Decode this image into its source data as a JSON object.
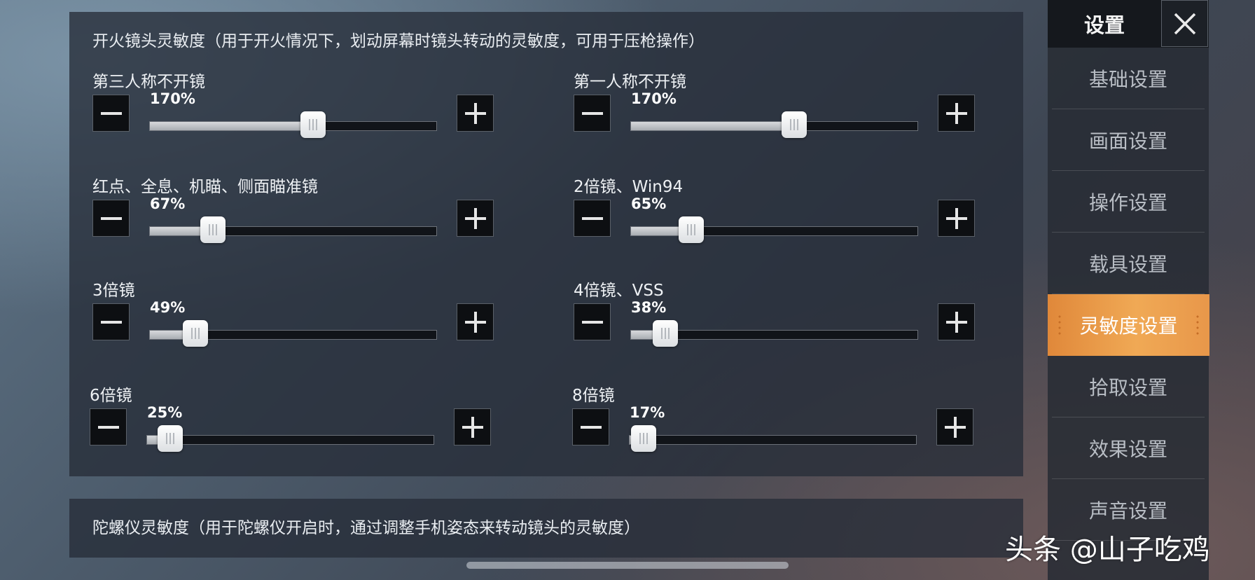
{
  "panel": {
    "title": "开火镜头灵敏度（用于开火情况下，划动屏幕时镜头转动的灵敏度，可用于压枪操作）",
    "sliders": [
      {
        "label": "第三人称不开镜",
        "value_text": "170%",
        "fraction": 0.57
      },
      {
        "label": "第一人称不开镜",
        "value_text": "170%",
        "fraction": 0.57
      },
      {
        "label": "红点、全息、机瞄、侧面瞄准镜",
        "value_text": "67%",
        "fraction": 0.22
      },
      {
        "label": "2倍镜、Win94",
        "value_text": "65%",
        "fraction": 0.21
      },
      {
        "label": "3倍镜",
        "value_text": "49%",
        "fraction": 0.16
      },
      {
        "label": "4倍镜、VSS",
        "value_text": "38%",
        "fraction": 0.12
      },
      {
        "label": "6倍镜",
        "value_text": "25%",
        "fraction": 0.08
      },
      {
        "label": "8倍镜",
        "value_text": "17%",
        "fraction": 0.05
      }
    ]
  },
  "gyro_panel": {
    "title": "陀螺仪灵敏度（用于陀螺仪开启时，通过调整手机姿态来转动镜头的灵敏度）"
  },
  "sidebar": {
    "title": "设置",
    "close_icon": "close-icon",
    "items": [
      {
        "label": "基础设置",
        "active": false
      },
      {
        "label": "画面设置",
        "active": false
      },
      {
        "label": "操作设置",
        "active": false
      },
      {
        "label": "载具设置",
        "active": false
      },
      {
        "label": "灵敏度设置",
        "active": true
      },
      {
        "label": "拾取设置",
        "active": false
      },
      {
        "label": "效果设置",
        "active": false
      },
      {
        "label": "声音设置",
        "active": false
      }
    ]
  },
  "watermark": "头条 @山子吃鸡",
  "colors": {
    "accent": "#f0a955",
    "panel": "#262d38",
    "track": "#111419",
    "fill": "#c8cbcf"
  }
}
